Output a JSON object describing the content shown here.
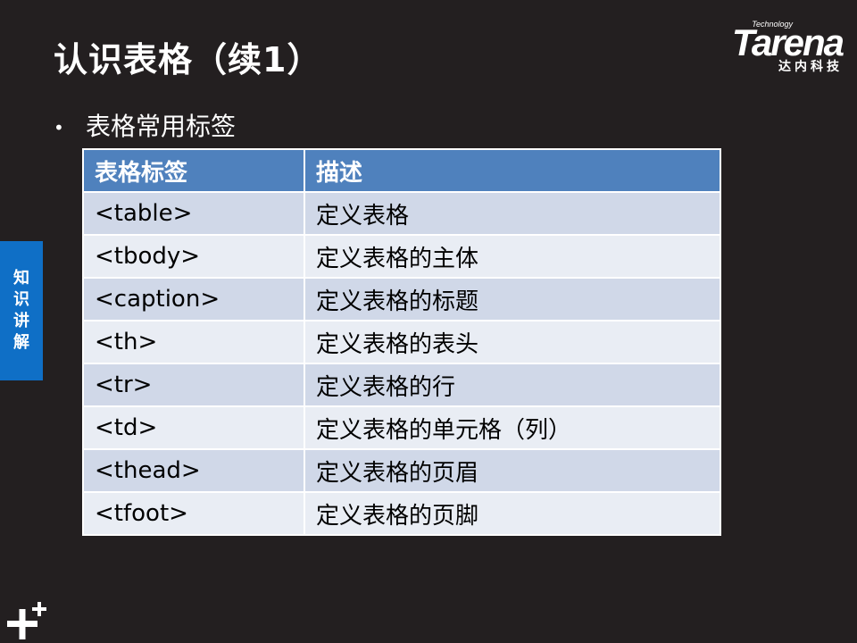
{
  "slide": {
    "title": "认识表格（续1）",
    "bullet": "表格常用标签",
    "side_tab": [
      "知",
      "识",
      "讲",
      "解"
    ]
  },
  "logo": {
    "small_text": "Technology",
    "brand": "Tarena",
    "chinese": "达内科技"
  },
  "table": {
    "headers": [
      "表格标签",
      "描述"
    ],
    "rows": [
      [
        "<table>",
        "定义表格"
      ],
      [
        "<tbody>",
        "定义表格的主体"
      ],
      [
        "<caption>",
        "定义表格的标题"
      ],
      [
        "<th>",
        "定义表格的表头"
      ],
      [
        "<tr>",
        "定义表格的行"
      ],
      [
        "<td>",
        "定义表格的单元格（列）"
      ],
      [
        "<thead>",
        "定义表格的页眉"
      ],
      [
        "<tfoot>",
        "定义表格的页脚"
      ]
    ]
  },
  "colors": {
    "background": "#231f20",
    "header": "#4f81bd",
    "row_odd": "#d0d8e8",
    "row_even": "#e9edf4",
    "side_tab": "#0f6fc6"
  },
  "icons": {
    "bottom_left": "plus-icon"
  }
}
